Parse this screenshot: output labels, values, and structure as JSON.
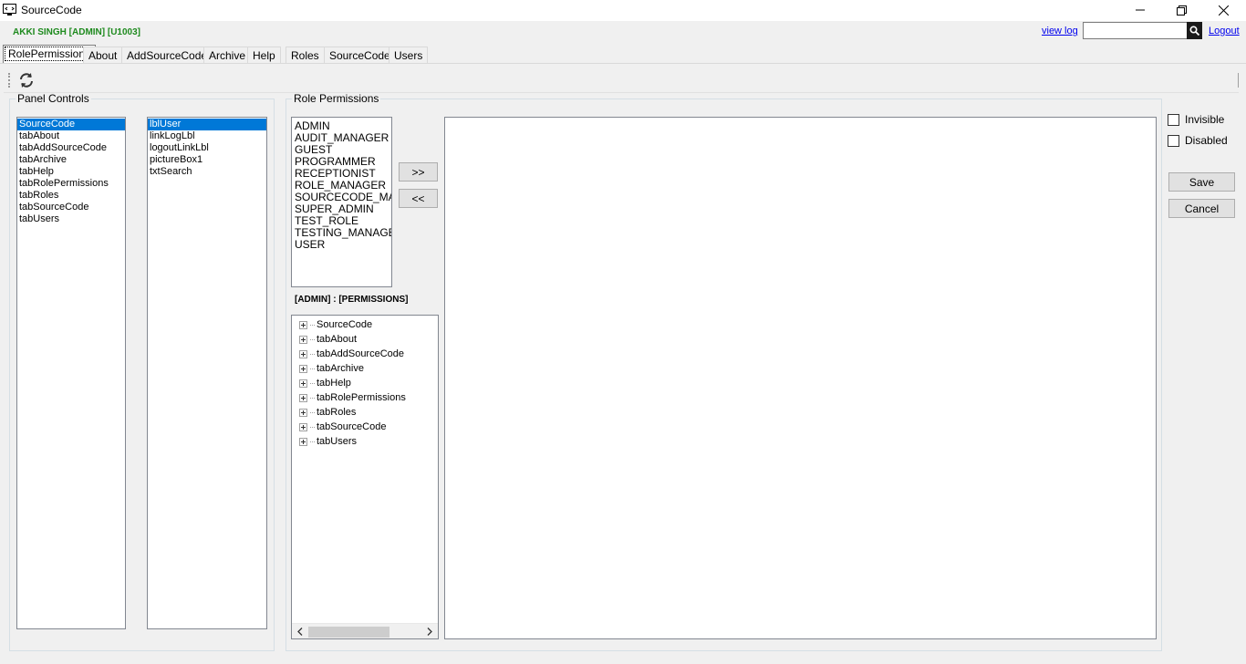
{
  "window": {
    "title": "SourceCode"
  },
  "header": {
    "user_label": "AKKI SINGH [ADMIN] [U1003]",
    "view_log": "view log",
    "search_value": "",
    "logout": "Logout"
  },
  "tabs": [
    {
      "label": "RolePermissions",
      "active": true
    },
    {
      "label": "About"
    },
    {
      "label": "AddSourceCode"
    },
    {
      "label": "Archive"
    },
    {
      "label": "Help"
    },
    {
      "label": "Roles"
    },
    {
      "label": "SourceCode"
    },
    {
      "label": "Users"
    }
  ],
  "panel_controls": {
    "legend": "Panel Controls",
    "controls": [
      "SourceCode",
      "tabAbout",
      "tabAddSourceCode",
      "tabArchive",
      "tabHelp",
      "tabRolePermissions",
      "tabRoles",
      "tabSourceCode",
      "tabUsers"
    ],
    "selected_control": "SourceCode",
    "members": [
      "lblUser",
      "linkLogLbl",
      "logoutLinkLbl",
      "pictureBox1",
      "txtSearch"
    ],
    "selected_member": "lblUser"
  },
  "role_permissions": {
    "legend": "Role Permissions",
    "roles": [
      "ADMIN",
      "AUDIT_MANAGER",
      "GUEST",
      "PROGRAMMER",
      "RECEPTIONIST",
      "ROLE_MANAGER",
      "SOURCECODE_MAN",
      "SUPER_ADMIN",
      "TEST_ROLE",
      "TESTING_MANAGER",
      "USER"
    ],
    "add_label": ">>",
    "remove_label": "<<",
    "permissions_label": "[ADMIN] : [PERMISSIONS]",
    "tree_nodes": [
      "SourceCode",
      "tabAbout",
      "tabAddSourceCode",
      "tabArchive",
      "tabHelp",
      "tabRolePermissions",
      "tabRoles",
      "tabSourceCode",
      "tabUsers"
    ]
  },
  "options": {
    "invisible_label": "Invisible",
    "invisible_checked": false,
    "disabled_label": "Disabled",
    "disabled_checked": false,
    "save_label": "Save",
    "cancel_label": "Cancel"
  }
}
